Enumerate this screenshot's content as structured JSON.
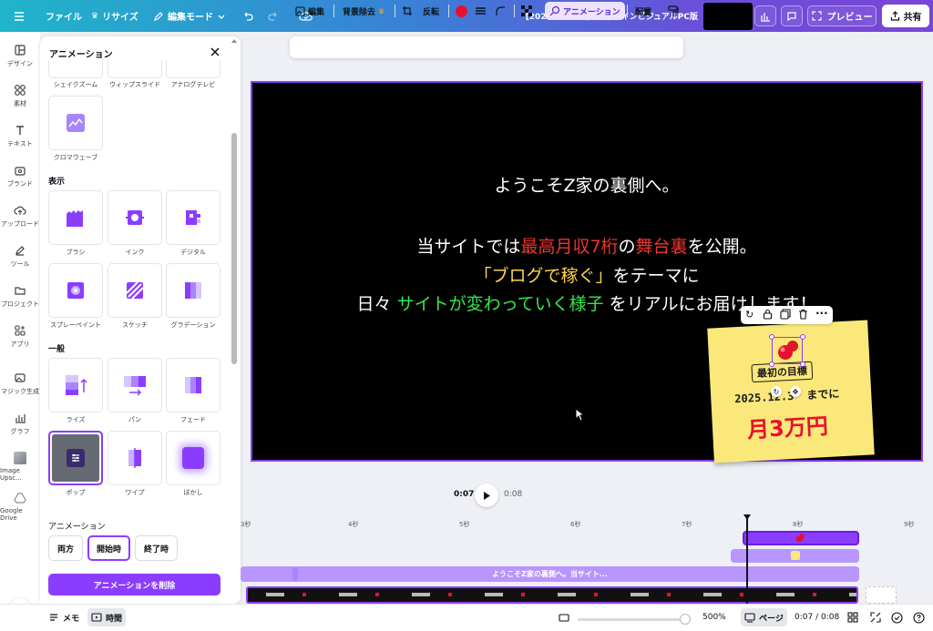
{
  "topbar": {
    "file": "ファイル",
    "resize": "リサイズ",
    "edit_mode": "編集モード",
    "title": "【2025008作業】裏側 メインビジュアルPC版",
    "preview": "プレビュー",
    "share": "共有"
  },
  "rail": {
    "items": [
      "デザイン",
      "素材",
      "テキスト",
      "ブランド",
      "アップロード",
      "ツール",
      "プロジェクト",
      "アプリ",
      "マジック生成",
      "グラフ",
      "Image Upsc...",
      "Google Drive"
    ]
  },
  "panel": {
    "title": "アニメーション",
    "top_row_labels": [
      "シェイクズーム",
      "ウィップスライド",
      "アナログテレビ"
    ],
    "chroma_label": "クロマウェーブ",
    "section_display": "表示",
    "display_row1": [
      "ブラシ",
      "インク",
      "デジタル"
    ],
    "display_row2": [
      "スプレーペイント",
      "スケッチ",
      "グラデーション"
    ],
    "section_general": "一般",
    "general_row1": [
      "ライズ",
      "パン",
      "フェード"
    ],
    "general_row2": [
      "ポップ",
      "ワイプ",
      "ぼかし"
    ],
    "section_animation": "アニメーション",
    "tabs": [
      "両方",
      "開始時",
      "終了時"
    ],
    "delete_button": "アニメーションを削除"
  },
  "context_toolbar": {
    "edit": "編集",
    "bg_remove": "背景除去",
    "flip": "反転",
    "animation": "アニメーション",
    "arrange": "配置",
    "accent": "#e8112d"
  },
  "canvas": {
    "line1": "ようこそZ家の裏側へ。",
    "line2_a": "当サイトでは",
    "line2_b": "最高月収7桁",
    "line2_c": "の",
    "line2_d": "舞台裏",
    "line2_e": "を公開。",
    "line3_a": "「ブログで稼ぐ」",
    "line3_b": "をテーマに",
    "line4_a": "日々 ",
    "line4_b": "サイトが変わっていく様子",
    "line4_c": " をリアルにお届けします！",
    "sticky_badge": "最初の目標",
    "sticky_date": "2025.12.3",
    "sticky_until": "までに",
    "sticky_goal": "月3万円"
  },
  "playback": {
    "current": "0:07",
    "total": "0:08"
  },
  "timeline": {
    "ruler": [
      "3秒",
      "4秒",
      "5秒",
      "6秒",
      "7秒",
      "8秒",
      "9秒"
    ],
    "text_track_label": "ようこそZ家の裏側へ。当サイト..."
  },
  "bottombar": {
    "memo": "メモ",
    "time": "時間",
    "zoom": "500%",
    "page": "ページ",
    "time_readout": "0:07 / 0:08"
  }
}
